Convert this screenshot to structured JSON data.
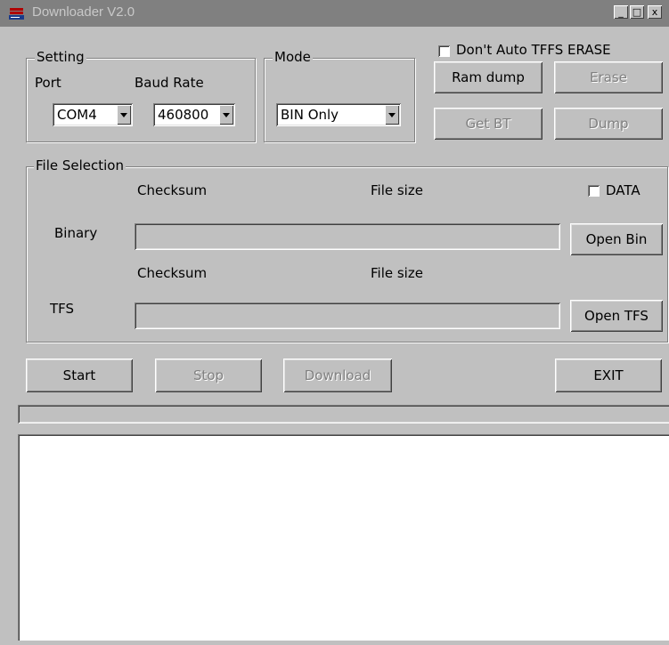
{
  "window": {
    "title": "Downloader V2.0",
    "minimize_glyph": "_",
    "maximize_glyph": "□",
    "close_glyph": "x",
    "icon": "downloader-app-icon"
  },
  "setting": {
    "legend": "Setting",
    "port_label": "Port",
    "baud_label": "Baud Rate",
    "port_value": "COM4",
    "baud_value": "460800"
  },
  "mode": {
    "legend": "Mode",
    "value": "BIN Only"
  },
  "options": {
    "dont_auto_erase_label": "Don't Auto TFFS ERASE",
    "dont_auto_erase_checked": false
  },
  "buttons": {
    "ram_dump": "Ram dump",
    "erase": "Erase",
    "get_bt": "Get BT",
    "dump": "Dump",
    "open_bin": "Open Bin",
    "open_tfs": "Open TFS",
    "start": "Start",
    "stop": "Stop",
    "download": "Download",
    "exit": "EXIT"
  },
  "file_selection": {
    "legend": "File Selection",
    "checksum_label": "Checksum",
    "filesize_label": "File size",
    "data_label": "DATA",
    "data_checked": false,
    "binary_label": "Binary",
    "binary_path": "",
    "tfs_label": "TFS",
    "tfs_path": ""
  },
  "progress": {
    "value": 0
  },
  "log": {
    "text": ""
  },
  "colors": {
    "face": "#c0c0c0",
    "title_inactive": "#808080",
    "disabled_text": "#808080"
  }
}
